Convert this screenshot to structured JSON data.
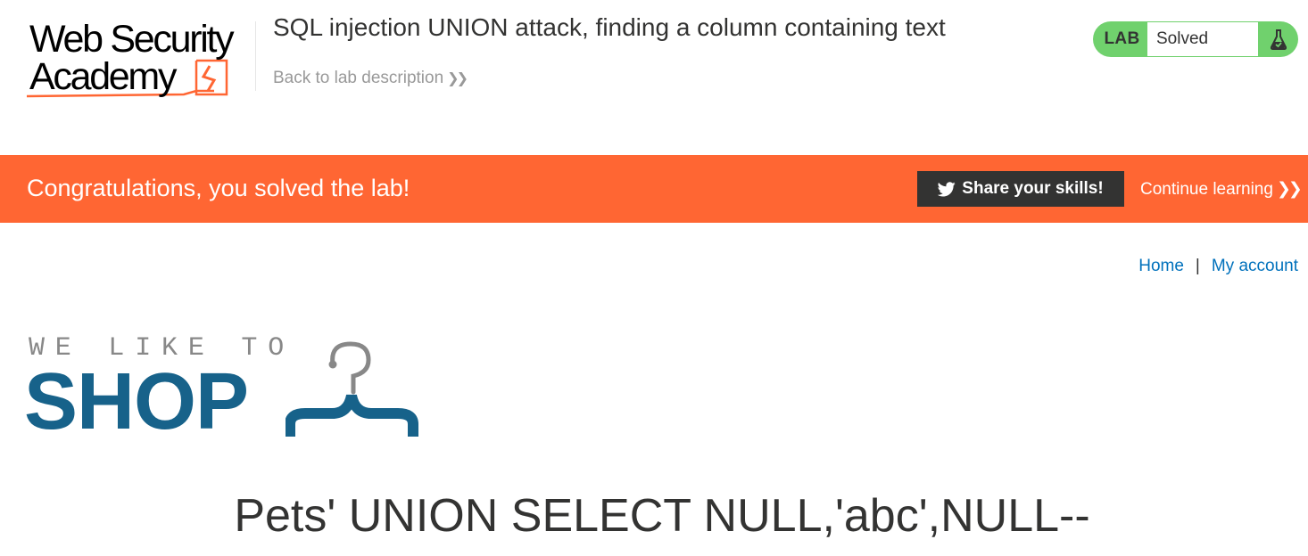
{
  "header": {
    "logo_line1": "Web Security",
    "logo_line2": "Academy",
    "lab_title": "SQL injection UNION attack, finding a column containing text",
    "back_link": "Back to lab description",
    "lab_tag": "LAB",
    "lab_status": "Solved"
  },
  "banner": {
    "message": "Congratulations, you solved the lab!",
    "share_label": "Share your skills!",
    "continue_label": "Continue learning"
  },
  "nav": {
    "home": "Home",
    "separator": "|",
    "account": "My account"
  },
  "shop": {
    "tagline": "WE LIKE TO",
    "name": "SHOP"
  },
  "main": {
    "category_heading": "Pets' UNION SELECT NULL,'abc',NULL--"
  },
  "icons": {
    "back_chevron": "double-chevron-right-icon",
    "continue_chevron": "double-chevron-right-icon",
    "share": "twitter-icon",
    "lab_status": "flask-icon",
    "shop_logo": "hanger-icon"
  },
  "colors": {
    "banner": "#ff6633",
    "lab_status": "#70d16d",
    "link": "#0071bc",
    "shop_brand": "#17628a",
    "share_button": "#333332"
  }
}
